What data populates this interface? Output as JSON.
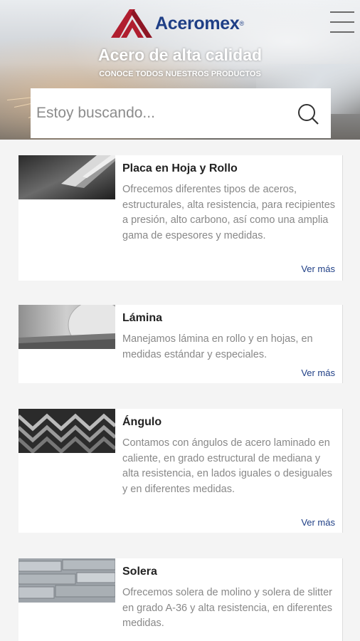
{
  "brand": {
    "name": "Aceromex",
    "registered": "®"
  },
  "hero": {
    "title": "Acero de alta calidad",
    "subtitle": "CONOCE TODOS NUESTROS PRODUCTOS"
  },
  "search": {
    "placeholder": "Estoy buscando..."
  },
  "colors": {
    "brand_blue": "#1f3f86",
    "brand_red": "#b01e2f",
    "link": "#1f3f86"
  },
  "products": [
    {
      "title": "Placa en Hoja y Rollo",
      "description": "Ofrecemos diferentes tipos de aceros, estructurales, alta resistencia, para recipientes a presión, alto carbono, así como una amplia gama de espesores y medidas.",
      "link": "Ver más"
    },
    {
      "title": "Lámina",
      "description": "Manejamos lámina en rollo y en hojas, en medidas estándar y especiales.",
      "link": "Ver más"
    },
    {
      "title": "Ángulo",
      "description": "Contamos con ángulos de acero laminado en caliente, en grado estructural de mediana y alta resistencia, en lados iguales o desiguales y en diferentes medidas.",
      "link": "Ver más"
    },
    {
      "title": "Solera",
      "description": "Ofrecemos solera de molino y solera de slitter en grado A-36 y alta resistencia, en diferentes medidas.",
      "link": ""
    }
  ]
}
